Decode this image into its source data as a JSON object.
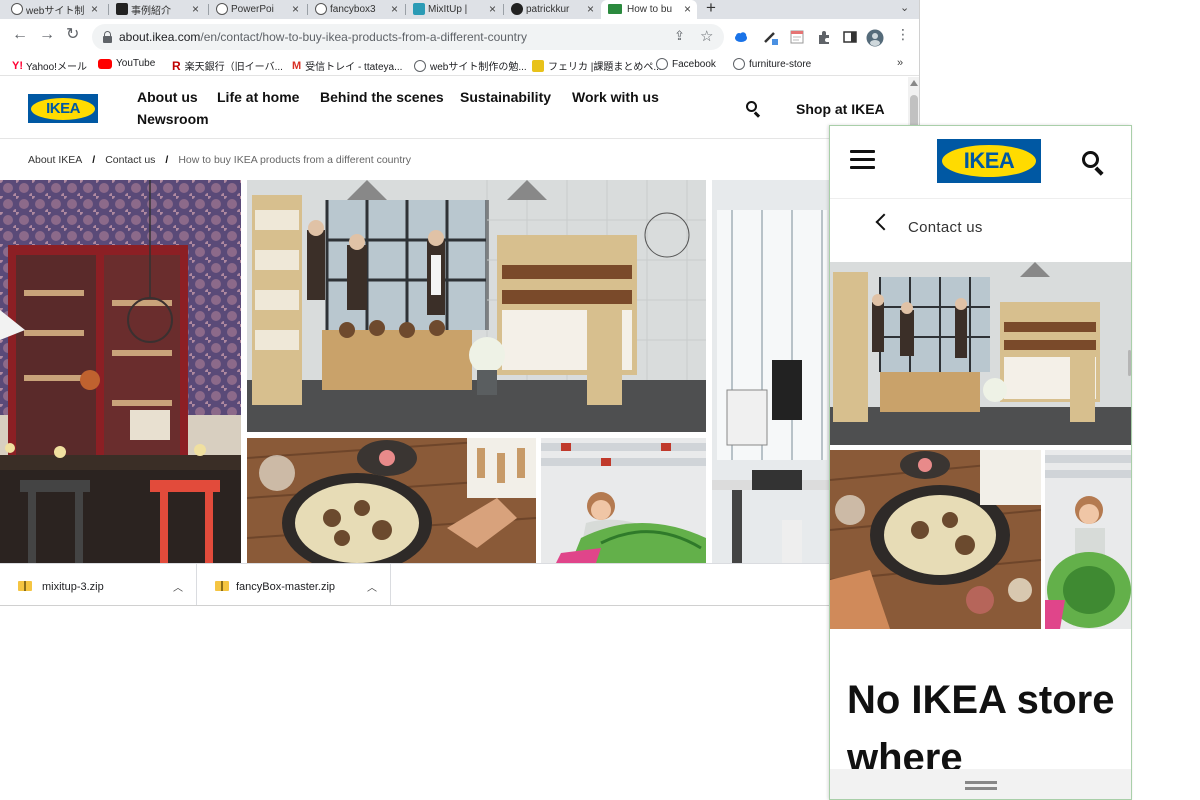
{
  "browser": {
    "tabs": [
      {
        "label": "webサイト制",
        "icon": "info-icon"
      },
      {
        "label": "事例紹介",
        "icon": "c-logo-icon"
      },
      {
        "label": "PowerPoi",
        "icon": "globe-icon"
      },
      {
        "label": "fancybox3",
        "icon": "globe-icon"
      },
      {
        "label": "MixItUp |",
        "icon": "mixitup-icon"
      },
      {
        "label": "patrickkur",
        "icon": "github-icon"
      },
      {
        "label": "How to bu",
        "icon": "flag-icon",
        "active": true
      }
    ],
    "url_domain": "about.ikea.com",
    "url_path": "/en/contact/how-to-buy-ikea-products-from-a-different-country",
    "bookmarks": [
      {
        "label": "Yahoo!メール",
        "color": "#ff0033"
      },
      {
        "label": "YouTube",
        "color": "#ff0000"
      },
      {
        "label": "楽天銀行（旧イーバ...",
        "color": "#bf0000"
      },
      {
        "label": "受信トレイ - ttateya...",
        "color": "#d93025"
      },
      {
        "label": "webサイト制作の勉...",
        "color": "#5f6368"
      },
      {
        "label": "フェリカ |課題まとめペ...",
        "color": "#e8c21a"
      },
      {
        "label": "Facebook",
        "color": "#5f6368"
      },
      {
        "label": "furniture-store",
        "color": "#5f6368"
      }
    ]
  },
  "site": {
    "logo_text": "IKEA",
    "nav": [
      "About us",
      "Life at home",
      "Behind the scenes",
      "Sustainability",
      "Work with us",
      "Newsroom"
    ],
    "shop_label": "Shop at IKEA",
    "breadcrumb": [
      "About IKEA",
      "Contact us",
      "How to buy IKEA products from a different country"
    ],
    "breadcrumb_sep": "/"
  },
  "downloads": [
    {
      "name": "mixitup-3.zip"
    },
    {
      "name": "fancyBox-master.zip"
    }
  ],
  "mobile": {
    "logo_text": "IKEA",
    "crumb": "Contact us",
    "heading": "No IKEA store where"
  },
  "colors": {
    "ikea_blue": "#0058a3",
    "ikea_yellow": "#ffdb00"
  }
}
